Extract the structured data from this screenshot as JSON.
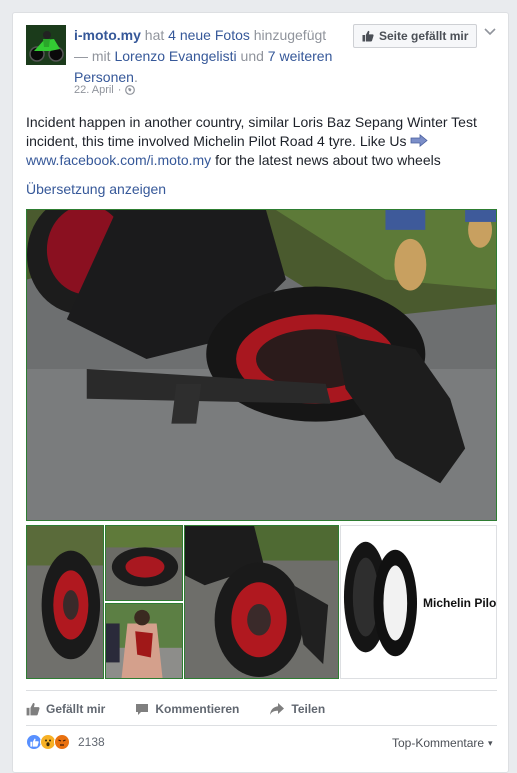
{
  "post": {
    "page_name": "i-moto.my",
    "added_pre": "hat",
    "photo_count_text": "4 neue Fotos",
    "added_post": "hinzugefügt",
    "with_pre": "— mit",
    "tagged_person": "Lorenzo Evangelisti",
    "and_text": "und",
    "others_text": "7 weiteren Personen",
    "period": ".",
    "date": "22. April",
    "separator": "·",
    "like_page_label": "Seite gefällt mir",
    "text_main": "Incident happen in another country, similar Loris Baz Sepang Winter Test incident, this time involved Michelin Pilot Road 4 tyre. Like Us",
    "text_link": "www.facebook.com/i.moto.my",
    "text_tail": "for the latest news about two wheels",
    "translate_label": "Übersetzung anzeigen",
    "tire_ad_text": "Michelin Pilo"
  },
  "actions": {
    "like": "Gefällt mir",
    "comment": "Kommentieren",
    "share": "Teilen"
  },
  "reactions": {
    "count": "2138",
    "sort_label": "Top-Kommentare",
    "sort_arrow": "▾"
  },
  "colors": {
    "link": "#365899",
    "muted": "#90949c",
    "like_blue": "#5890ff",
    "wow_yellow": "#f7b125",
    "angry_orange": "#e9710f"
  },
  "icons": {
    "avatar": "motorcycle-avatar",
    "globe": "globe-icon",
    "thumb": "thumbs-up-icon",
    "comment": "comment-icon",
    "share": "share-icon",
    "arrow": "right-arrow-emoji"
  }
}
